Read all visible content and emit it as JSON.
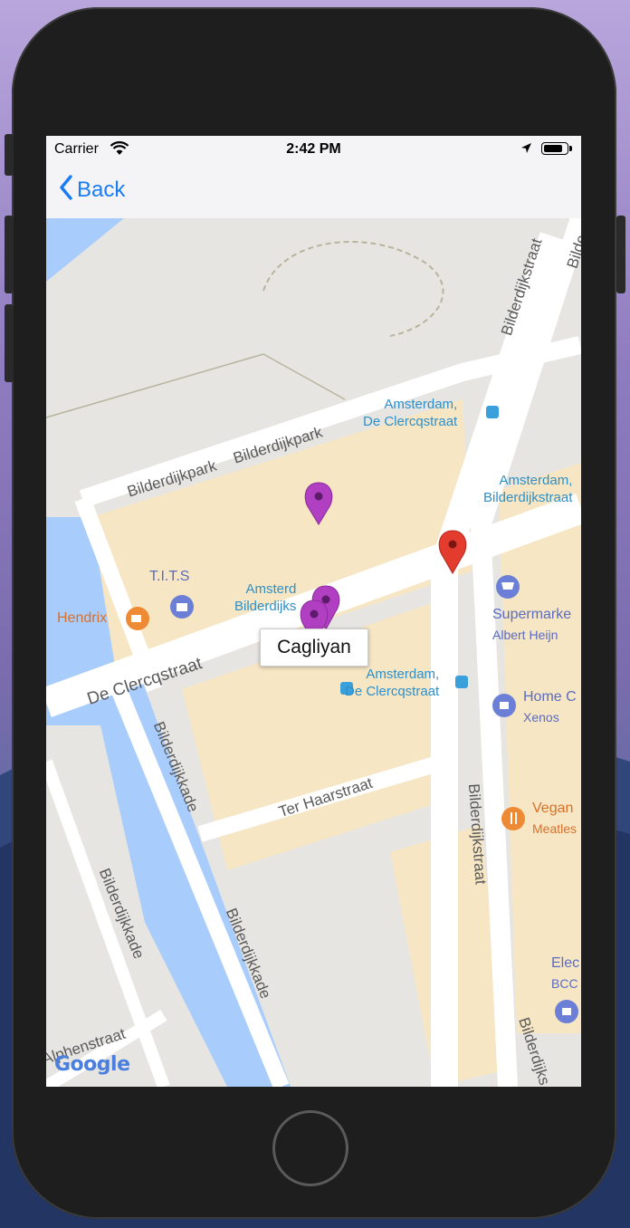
{
  "status_bar": {
    "carrier": "Carrier",
    "time": "2:42 PM",
    "battery_level": 0.85
  },
  "nav": {
    "back_label": "Back"
  },
  "map": {
    "info_window": "Cagliyan",
    "attribution": "Google",
    "roads": {
      "bilderdijkpark_1": "Bilderdijkpark",
      "bilderdijkpark_2": "Bilderdijkpark",
      "bilderdijkstraat_top": "Bilderdijkstraat",
      "bilderdijkstraat_top2": "Bilde",
      "bilderdijkstraat_mid": "Bilderdijkstraat",
      "bilderdijkstraat_bottom": "Bilderdijks",
      "de_clercqstraat": "De Clercqstraat",
      "bilderdijkkade_1": "Bilderdijkkade",
      "bilderdijkkade_2": "Bilderdijkkade",
      "bilderdijkkade_3": "Bilderdijkkade",
      "ter_haarstraat": "Ter Haarstraat",
      "alphenstraat": "Alphenstraat"
    },
    "transit": {
      "stop_1_line1": "Amsterdam,",
      "stop_1_line2": "De Clercqstraat",
      "stop_2_line1": "Amsterdam,",
      "stop_2_line2": "Bilderdijkstraat",
      "stop_3_line1": "Amsterd",
      "stop_3_line2": "Bilderdijks",
      "stop_4_line1": "Amsterdam,",
      "stop_4_line2": "De Clercqstraat"
    },
    "pois": {
      "tits": "T.I.T.S",
      "hendrix": "Hendrix",
      "supermarket_title": "Supermarke",
      "supermarket_sub": "Albert Heijn",
      "home_title": "Home C",
      "home_sub": "Xenos",
      "vegan_title": "Vegan",
      "vegan_sub": "Meatles",
      "elec_title": "Elec",
      "elec_sub": "BCC"
    },
    "colors": {
      "water": "#a8ccfb",
      "road": "#ffffff",
      "block": "#f6e6c4",
      "marker_purple": "#b03fc2",
      "marker_red": "#e33b2e",
      "poi_purple": "#6c7fd6",
      "poi_orange": "#ee8a33"
    }
  }
}
